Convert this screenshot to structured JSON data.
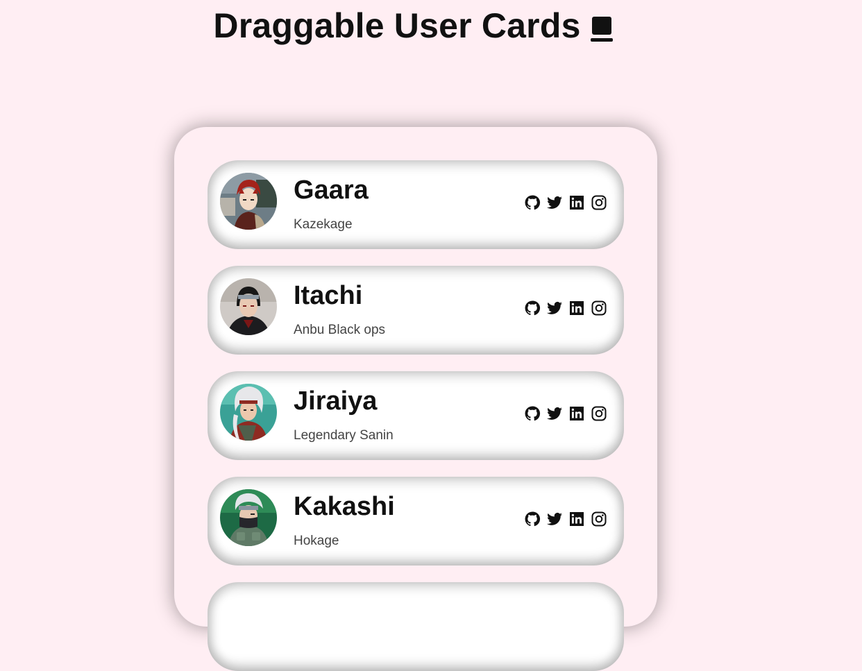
{
  "page": {
    "title": "Draggable User Cards",
    "title_icon": "book-icon",
    "background": "#ffeef3"
  },
  "cards": [
    {
      "name": "Gaara",
      "role": "Kazekage",
      "avatar_icon": "avatar-gaara",
      "socials": [
        "github-icon",
        "twitter-icon",
        "linkedin-icon",
        "instagram-icon"
      ]
    },
    {
      "name": "Itachi",
      "role": "Anbu Black ops",
      "avatar_icon": "avatar-itachi",
      "socials": [
        "github-icon",
        "twitter-icon",
        "linkedin-icon",
        "instagram-icon"
      ]
    },
    {
      "name": "Jiraiya",
      "role": "Legendary Sanin",
      "avatar_icon": "avatar-jiraiya",
      "socials": [
        "github-icon",
        "twitter-icon",
        "linkedin-icon",
        "instagram-icon"
      ]
    },
    {
      "name": "Kakashi",
      "role": "Hokage",
      "avatar_icon": "avatar-kakashi",
      "socials": [
        "github-icon",
        "twitter-icon",
        "linkedin-icon",
        "instagram-icon"
      ]
    }
  ]
}
